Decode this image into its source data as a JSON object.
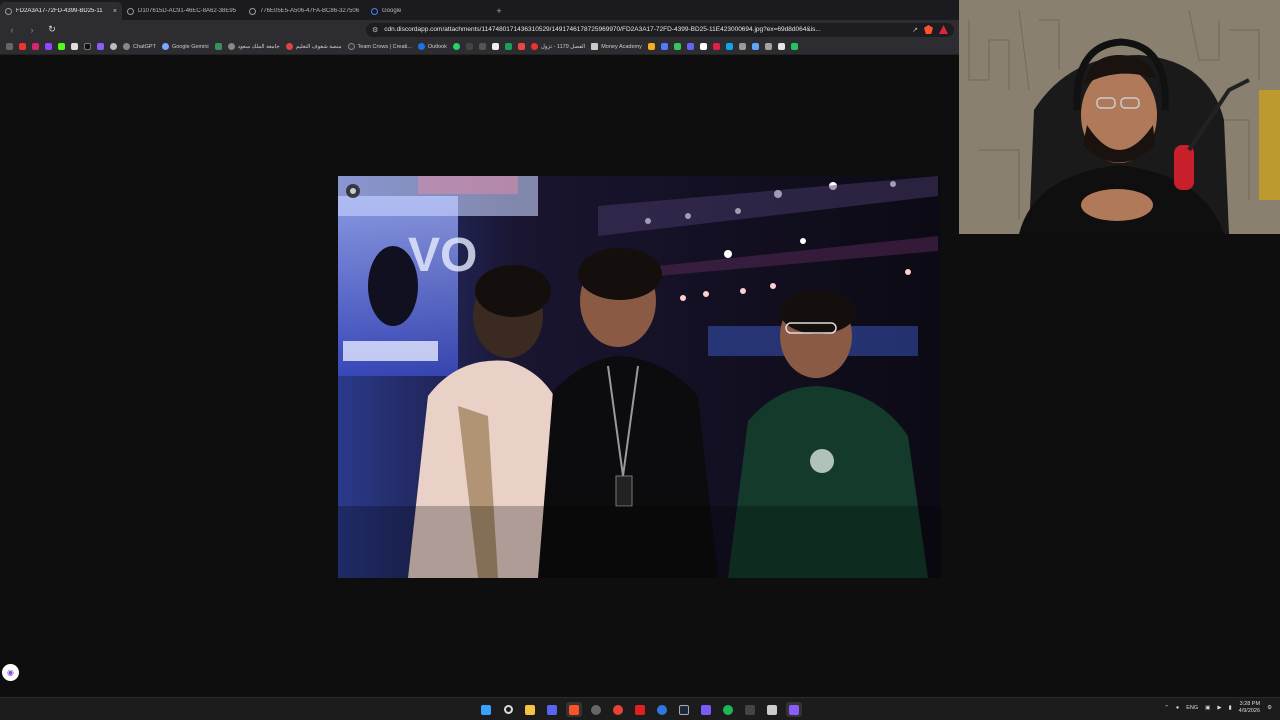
{
  "browser": {
    "tabs": [
      {
        "title": "FD2A3A17-72FD-4399-BD25-11",
        "active": true
      },
      {
        "title": "D107615D-AC91-46EC-8A62-38E95",
        "active": false
      },
      {
        "title": "776E05E5-A506-47FA-BC86-327506",
        "active": false
      },
      {
        "title": "Google",
        "active": false
      }
    ],
    "new_tab_glyph": "+",
    "close_glyph": "×",
    "url": "cdn.discordapp.com/attachments/1147480171436310529/1491746178725969970/FD2A3A17-72FD-4399-BD25-11E423000694.jpg?ex=69d8d064&is...",
    "bookmarks": [
      {
        "label": "ChatGPT"
      },
      {
        "label": "Google Gemini"
      },
      {
        "label": "جامعة الملك سعود"
      },
      {
        "label": "منصة شغوف التعليم"
      },
      {
        "label": "Team Crows | Creati..."
      },
      {
        "label": "Outlook"
      },
      {
        "label": "الفصل 1179 - تزول"
      },
      {
        "label": "Money Academy"
      }
    ]
  },
  "taskbar": {
    "language": "ENG",
    "time": "3:28 PM",
    "date": "4/9/2026"
  },
  "colors": {
    "page_bg": "#0e0e0e",
    "chrome_bg": "#2c2c31",
    "taskbar_bg": "#1c1c1c"
  }
}
